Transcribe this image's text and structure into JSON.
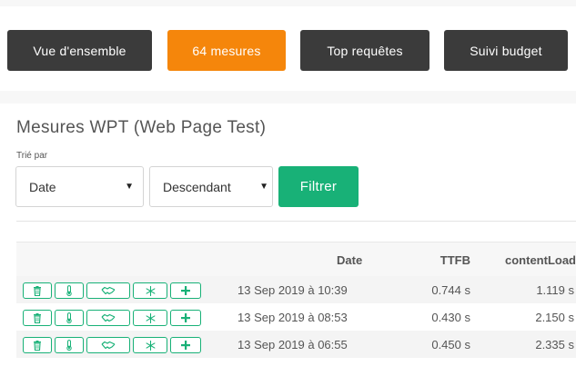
{
  "nav": {
    "tabs": [
      {
        "label": "Vue d'ensemble"
      },
      {
        "label": "64 mesures"
      },
      {
        "label": "Top requêtes"
      },
      {
        "label": "Suivi budget"
      }
    ]
  },
  "page": {
    "title": "Mesures WPT (Web Page Test)"
  },
  "sort": {
    "label": "Trié par",
    "field_value": "Date",
    "order_value": "Descendant",
    "filter_label": "Filtrer"
  },
  "table": {
    "headers": {
      "date": "Date",
      "ttfb": "TTFB",
      "content_load": "contentLoad"
    },
    "rows": [
      {
        "date": "13 Sep 2019 à 10:39",
        "ttfb": "0.744 s",
        "content_load": "1.119 s"
      },
      {
        "date": "13 Sep 2019 à 08:53",
        "ttfb": "0.430 s",
        "content_load": "2.150 s"
      },
      {
        "date": "13 Sep 2019 à 06:55",
        "ttfb": "0.450 s",
        "content_load": "2.335 s"
      }
    ]
  },
  "icons": {
    "row_actions": [
      "trash-icon",
      "thermometer-icon",
      "handshake-icon",
      "snowflake-icon",
      "plus-icon"
    ]
  },
  "colors": {
    "accent_orange": "#f5860b",
    "accent_green": "#18b177",
    "nav_dark": "#3b3b3b"
  }
}
